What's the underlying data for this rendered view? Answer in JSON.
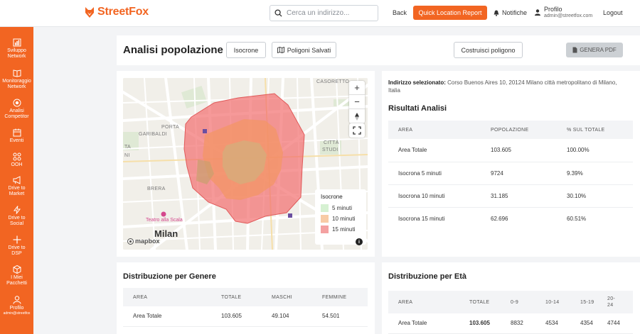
{
  "brand": {
    "name": "StreetFox",
    "accent": "#f26522"
  },
  "header": {
    "search_placeholder": "Cerca un indirizzo...",
    "back": "Back",
    "quick_report": "Quick Location Report",
    "notifications": "Notifiche",
    "profile_name": "Profilo",
    "profile_email": "admin@streetfox.com",
    "logout": "Logout"
  },
  "sidebar": {
    "items": [
      {
        "label": "Sviluppo\nNetwork",
        "icon": "bar-chart-icon"
      },
      {
        "label": "Monitoraggio\nNetwork",
        "icon": "book-icon"
      },
      {
        "label": "Analisi\nCompetitor",
        "icon": "target-icon"
      },
      {
        "label": "Eventi",
        "icon": "calendar-icon"
      },
      {
        "label": "OOH",
        "icon": "grid-icon"
      },
      {
        "label": "Drive to\nMarket",
        "icon": "megaphone-icon"
      },
      {
        "label": "Drive to\nSocial",
        "icon": "bolt-icon"
      },
      {
        "label": "Drive to\nDSP",
        "icon": "plus-icon"
      },
      {
        "label": "I Miei\nPacchetti",
        "icon": "package-icon"
      },
      {
        "label": "Profilo",
        "sub": "admin@streetfox",
        "icon": "user-icon"
      }
    ]
  },
  "page": {
    "title": "Analisi popolazione",
    "isocrone_btn": "Isocrone",
    "saved_polygons_btn": "Poligoni Salvati",
    "build_polygon_btn": "Costruisci poligono",
    "pdf_btn": "GENERA PDF"
  },
  "map": {
    "labels": {
      "milan": "Milan",
      "teatro": "Teatro alla Scala",
      "porta": "PORTA",
      "garibaldi": "GARIBALDI",
      "brera": "BRERA",
      "casoretto": "CASORETTO",
      "citta": "CITTÀ",
      "studi": "STUDI",
      "ta": "TA",
      "ni": "NI"
    },
    "attribution": "mapbox",
    "legend": {
      "title": "Isocrone",
      "items": [
        {
          "label": "5 minuti",
          "color": "#d6f1d2"
        },
        {
          "label": "10 minuti",
          "color": "#f8cba6"
        },
        {
          "label": "15 minuti",
          "color": "#f4a1a1"
        }
      ]
    }
  },
  "results": {
    "address_label": "Indirizzo selezionato:",
    "address_value": "Corso Buenos Aires 10, 20124 Milano città metropolitano di Milano, Italia",
    "title": "Risultati Analisi",
    "headers": [
      "AREA",
      "POPOLAZIONE",
      "% SUL TOTALE"
    ],
    "rows": [
      [
        "Area Totale",
        "103.605",
        "100.00%"
      ],
      [
        "Isocrona 5 minuti",
        "9724",
        "9.39%"
      ],
      [
        "Isocrona 10 minuti",
        "31.185",
        "30.10%"
      ],
      [
        "Isocrona 15 minuti",
        "62.696",
        "60.51%"
      ]
    ]
  },
  "gender": {
    "title": "Distribuzione per Genere",
    "headers": [
      "AREA",
      "TOTALE",
      "MASCHI",
      "FEMMINE"
    ],
    "rows": [
      [
        "Area Totale",
        "103.605",
        "49.104",
        "54.501"
      ]
    ]
  },
  "age": {
    "title": "Distribuzione per Età",
    "headers": [
      "AREA",
      "TOTALE",
      "0-9",
      "10-14",
      "15-19",
      "20-\n24"
    ],
    "rows": [
      [
        "Area Totale",
        "103.605",
        "8832",
        "4534",
        "4354",
        "4744"
      ]
    ]
  }
}
